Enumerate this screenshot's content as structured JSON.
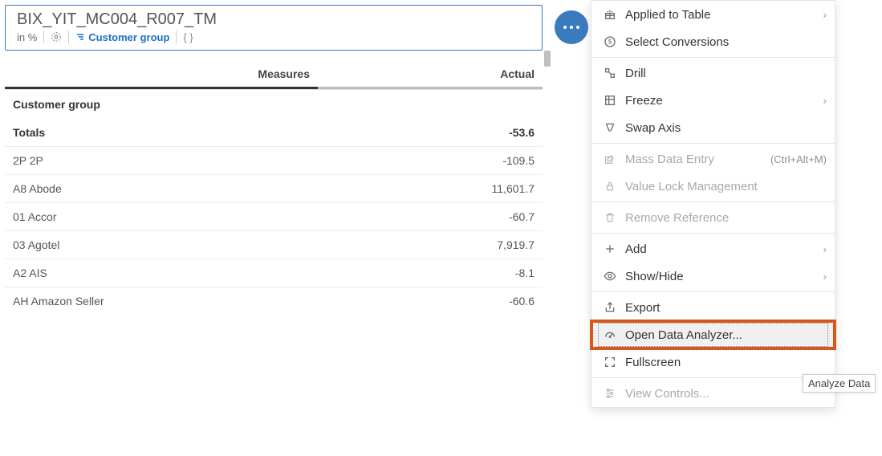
{
  "card": {
    "title": "BIX_YIT_MC004_R007_TM",
    "unit": "in %",
    "dimension_label": "Customer group"
  },
  "table": {
    "col_measures": "Measures",
    "col_actual": "Actual",
    "section": "Customer group",
    "totals_label": "Totals",
    "totals_value": "-53.6",
    "rows": [
      {
        "label": "2P 2P",
        "value": "-109.5"
      },
      {
        "label": "A8 Abode",
        "value": "11,601.7"
      },
      {
        "label": "01 Accor",
        "value": "-60.7"
      },
      {
        "label": "03 Agotel",
        "value": "7,919.7"
      },
      {
        "label": "A2 AIS",
        "value": "-8.1"
      },
      {
        "label": "AH Amazon Seller",
        "value": "-60.6"
      }
    ]
  },
  "menu": {
    "applied_to_table": "Applied to Table",
    "select_conversions": "Select Conversions",
    "drill": "Drill",
    "freeze": "Freeze",
    "swap_axis": "Swap Axis",
    "mass_data_entry": "Mass Data Entry",
    "mass_data_entry_hint": "(Ctrl+Alt+M)",
    "value_lock": "Value Lock Management",
    "remove_reference": "Remove Reference",
    "add": "Add",
    "show_hide": "Show/Hide",
    "export": "Export",
    "open_data_analyzer": "Open Data Analyzer...",
    "fullscreen": "Fullscreen",
    "view_controls": "View Controls..."
  },
  "tooltip": "Analyze Data"
}
